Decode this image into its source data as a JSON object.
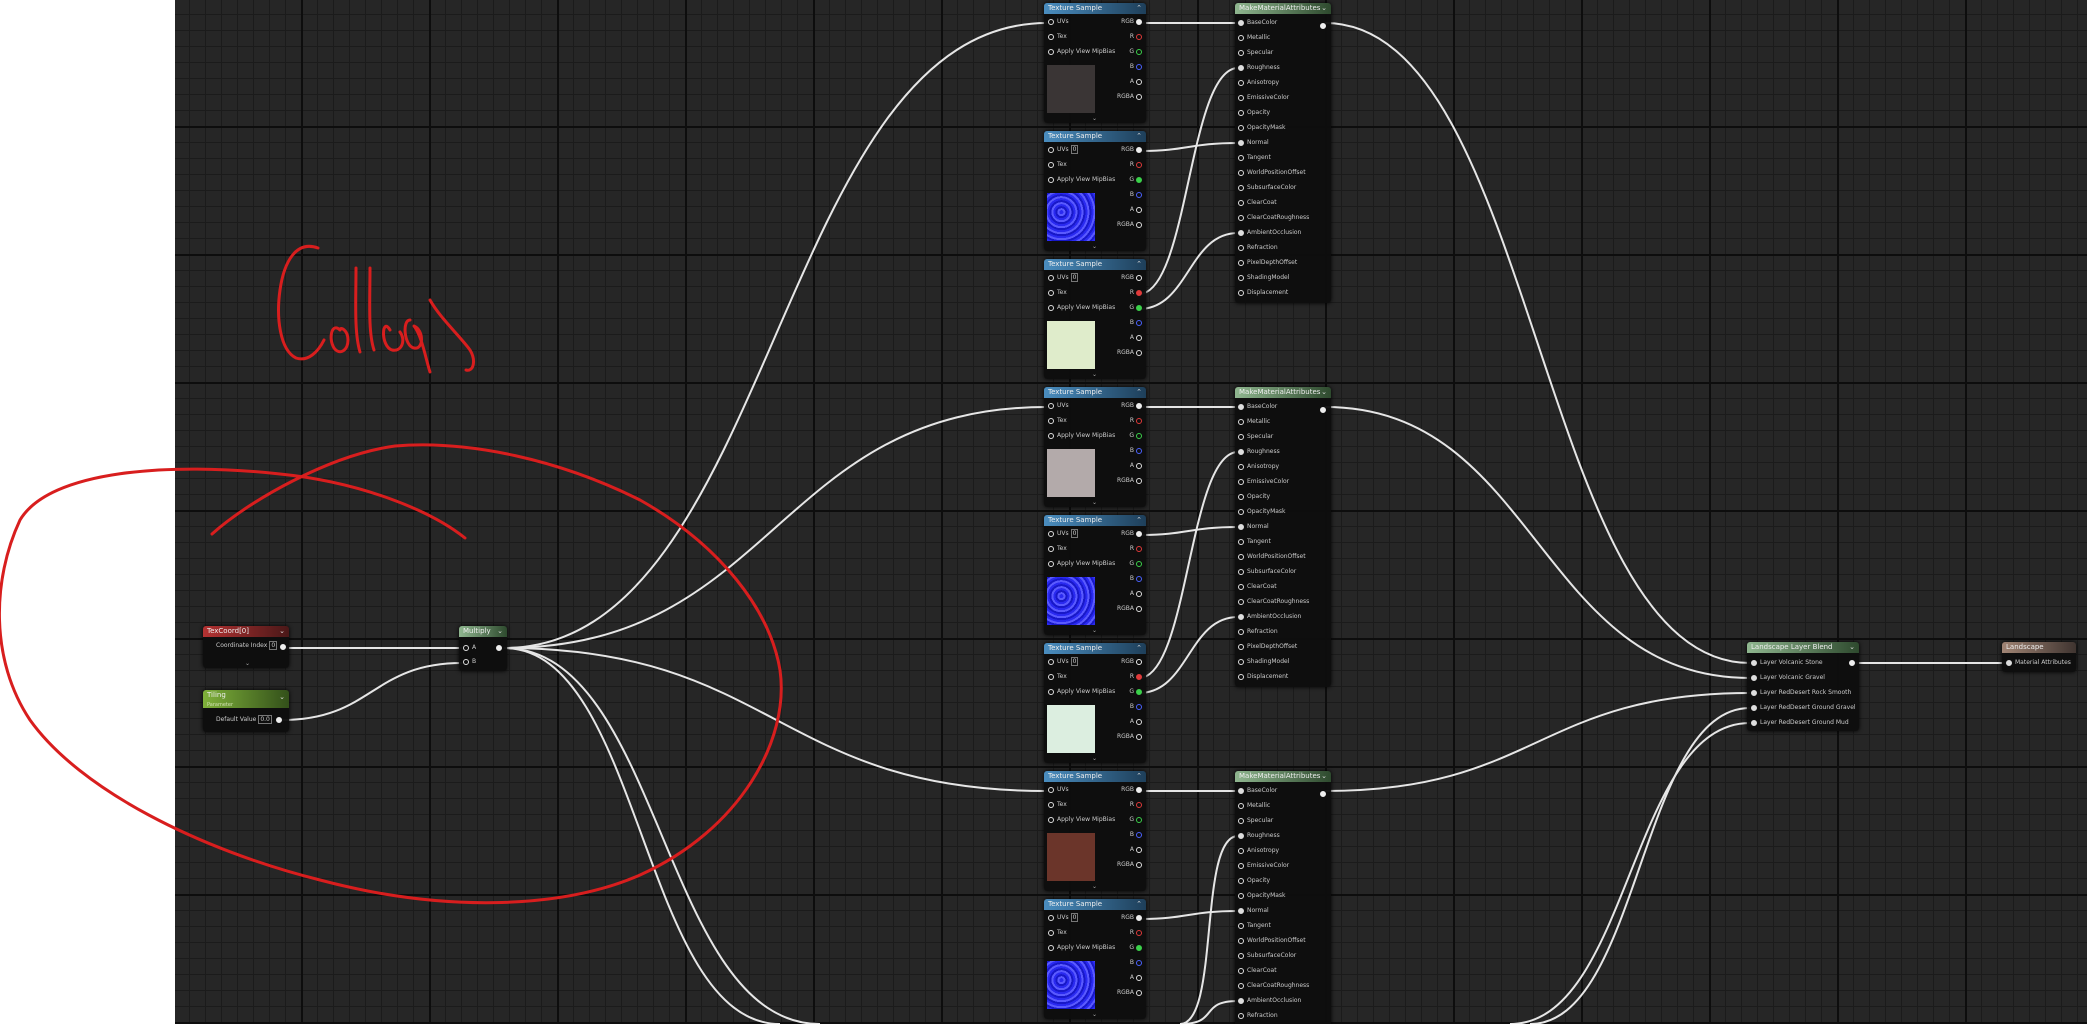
{
  "labels": {
    "texture_sample": "Texture Sample",
    "make_material_attributes": "MakeMaterialAttributes",
    "texcoord": "TexCoord[0]",
    "multiply": "Multiply",
    "tiling": "Tiling",
    "tiling_sub": "Parameter",
    "landscape_layer_blend": "Landscape Layer Blend",
    "landscape": "Landscape"
  },
  "texture_pins_in": [
    "UVs",
    "Tex",
    "Apply View MipBias"
  ],
  "texture_pins_out": [
    "RGB",
    "R",
    "G",
    "B",
    "A",
    "RGBA"
  ],
  "uv_index_value": "0",
  "mma_pins": [
    "BaseColor",
    "Metallic",
    "Specular",
    "Roughness",
    "Anisotropy",
    "EmissiveColor",
    "Opacity",
    "OpacityMask",
    "Normal",
    "Tangent",
    "WorldPositionOffset",
    "SubsurfaceColor",
    "ClearCoat",
    "ClearCoatRoughness",
    "AmbientOcclusion",
    "Refraction",
    "PixelDepthOffset",
    "ShadingModel",
    "Displacement"
  ],
  "texcoord": {
    "pin_label": "Coordinate Index",
    "value": "0"
  },
  "multiply": {
    "pin_a": "A",
    "pin_b": "B"
  },
  "tiling": {
    "pin_label": "Default Value",
    "value": "0.0"
  },
  "landscape_layer_blend": {
    "layers": [
      "Layer Volcanic Stone",
      "Layer Volcanic Gravel",
      "Layer RedDesert Rock Smooth",
      "Layer RedDesert Ground Gravel",
      "Layer RedDesert Ground Mud"
    ]
  },
  "landscape": {
    "pin": "Material Attributes"
  },
  "thumbnails": [
    "#3a3535",
    "blue-normal",
    "#dfeccb",
    "#b3aaaa",
    "blue-normal",
    "#dceee0",
    "#6b352a",
    "blue-normal"
  ],
  "annotation": {
    "handwriting": "College",
    "ink_color": "#d81e1e"
  },
  "colors": {
    "r_pin": "#e03a3a",
    "g_pin": "#3bd04a",
    "b_pin": "#4a62ff",
    "wire": "#e6e6e6",
    "grid_bg": "#262626"
  }
}
